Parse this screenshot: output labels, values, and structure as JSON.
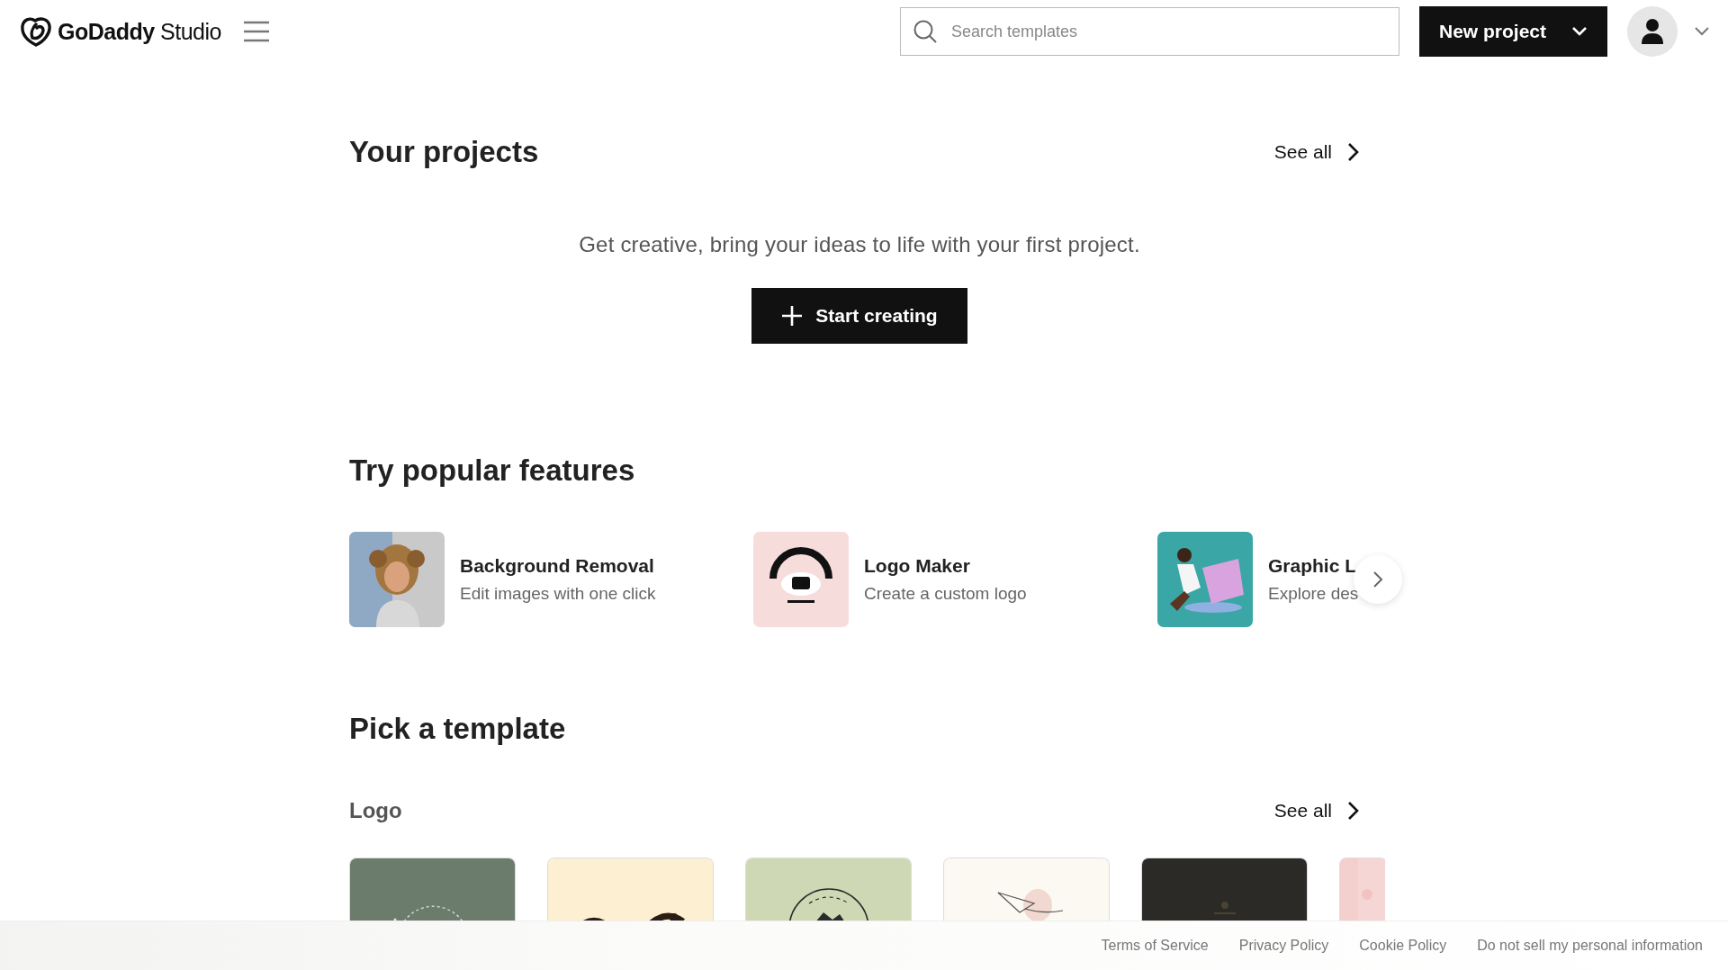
{
  "header": {
    "logo": "**GoDaddy** Studio",
    "search": {
      "placeholder": "Search templates"
    },
    "new_project": "New project"
  },
  "projects": {
    "title": "Your projects",
    "see_all": "See all",
    "empty_message": "Get creative, bring your ideas to life with your first project.",
    "start_button": "Start creating"
  },
  "features": {
    "title": "Try popular features",
    "items": [
      {
        "title": "Background Removal",
        "subtitle": "Edit images with one click"
      },
      {
        "title": "Logo Maker",
        "subtitle": "Create a custom logo"
      },
      {
        "title": "Graphic L",
        "subtitle": "Explore des"
      }
    ]
  },
  "templates": {
    "title": "Pick a template",
    "category": "Logo",
    "see_all": "See all"
  },
  "footer": {
    "links": [
      "Terms of Service",
      "Privacy Policy",
      "Cookie Policy",
      "Do not sell my personal information"
    ]
  }
}
